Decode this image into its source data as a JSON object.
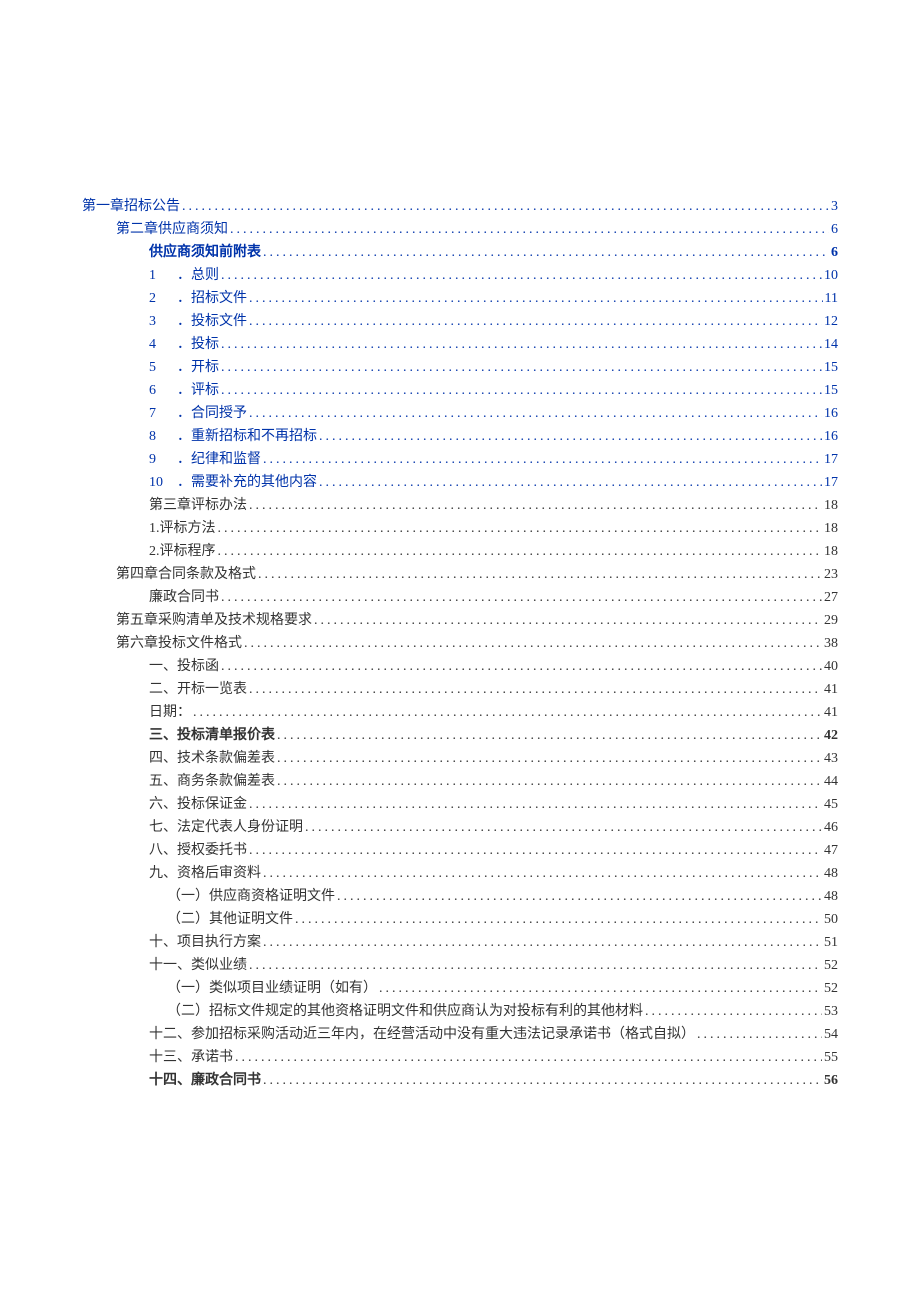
{
  "toc": [
    {
      "level": 0,
      "prefix": "",
      "label": "第一章招标公告",
      "page": "3",
      "link": true,
      "bold": false
    },
    {
      "level": 1,
      "prefix": "",
      "label": "第二章供应商须知",
      "page": "6",
      "link": true,
      "bold": false
    },
    {
      "level": 2,
      "prefix": "",
      "label": "供应商须知前附表",
      "page": "6",
      "link": true,
      "bold": true
    },
    {
      "level": 2,
      "prefix": "1",
      "label": "．总则",
      "page": "10",
      "link": true,
      "bold": false
    },
    {
      "level": 2,
      "prefix": "2",
      "label": "．招标文件",
      "page": "11",
      "link": true,
      "bold": false
    },
    {
      "level": 2,
      "prefix": "3",
      "label": "．投标文件",
      "page": "12",
      "link": true,
      "bold": false
    },
    {
      "level": 2,
      "prefix": "4",
      "label": "．投标",
      "page": "14",
      "link": true,
      "bold": false
    },
    {
      "level": 2,
      "prefix": "5",
      "label": "．开标",
      "page": "15",
      "link": true,
      "bold": false
    },
    {
      "level": 2,
      "prefix": "6",
      "label": "．评标",
      "page": "15",
      "link": true,
      "bold": false
    },
    {
      "level": 2,
      "prefix": "7",
      "label": "．合同授予",
      "page": "16",
      "link": true,
      "bold": false
    },
    {
      "level": 2,
      "prefix": "8",
      "label": "．重新招标和不再招标",
      "page": "16",
      "link": true,
      "bold": false
    },
    {
      "level": 2,
      "prefix": "9",
      "label": "．纪律和监督",
      "page": "17",
      "link": true,
      "bold": false
    },
    {
      "level": 2,
      "prefix": "10",
      "label": "．需要补充的其他内容",
      "page": "17",
      "link": true,
      "bold": false
    },
    {
      "level": 2,
      "prefix": "",
      "label": "第三章评标办法",
      "page": "18",
      "link": false,
      "bold": false
    },
    {
      "level": 2,
      "prefix": "",
      "label": "1.评标方法",
      "page": "18",
      "link": false,
      "bold": false
    },
    {
      "level": 2,
      "prefix": "",
      "label": "2.评标程序",
      "page": "18",
      "link": false,
      "bold": false
    },
    {
      "level": 1,
      "prefix": "",
      "label": "第四章合同条款及格式",
      "page": "23",
      "link": false,
      "bold": false
    },
    {
      "level": 2,
      "prefix": "",
      "label": "廉政合同书",
      "page": "27",
      "link": false,
      "bold": false
    },
    {
      "level": 1,
      "prefix": "",
      "label": "第五章采购清单及技术规格要求",
      "page": "29",
      "link": false,
      "bold": false
    },
    {
      "level": 1,
      "prefix": "",
      "label": "第六章投标文件格式",
      "page": "38",
      "link": false,
      "bold": false
    },
    {
      "level": 2,
      "prefix": "",
      "label": "一、投标函",
      "page": "40",
      "link": false,
      "bold": false
    },
    {
      "level": 2,
      "prefix": "",
      "label": "二、开标一览表",
      "page": "41",
      "link": false,
      "bold": false
    },
    {
      "level": 2,
      "prefix": "",
      "label": "日期：",
      "page": "41",
      "link": false,
      "bold": false
    },
    {
      "level": 2,
      "prefix": "",
      "label": "三、投标清单报价表",
      "page": "42",
      "link": false,
      "bold": true
    },
    {
      "level": 2,
      "prefix": "",
      "label": "四、技术条款偏差表",
      "page": "43",
      "link": false,
      "bold": false
    },
    {
      "level": 2,
      "prefix": "",
      "label": "五、商务条款偏差表",
      "page": "44",
      "link": false,
      "bold": false
    },
    {
      "level": 2,
      "prefix": "",
      "label": "六、投标保证金",
      "page": "45",
      "link": false,
      "bold": false
    },
    {
      "level": 2,
      "prefix": "",
      "label": "七、法定代表人身份证明",
      "page": "46",
      "link": false,
      "bold": false
    },
    {
      "level": 2,
      "prefix": "",
      "label": "八、授权委托书",
      "page": "47",
      "link": false,
      "bold": false
    },
    {
      "level": 2,
      "prefix": "",
      "label": "九、资格后审资料",
      "page": "48",
      "link": false,
      "bold": false
    },
    {
      "level": 3,
      "prefix": "",
      "label": "（一）供应商资格证明文件",
      "page": "48",
      "link": false,
      "bold": false
    },
    {
      "level": 3,
      "prefix": "",
      "label": "（二）其他证明文件",
      "page": "50",
      "link": false,
      "bold": false
    },
    {
      "level": 2,
      "prefix": "",
      "label": "十、项目执行方案",
      "page": "51",
      "link": false,
      "bold": false
    },
    {
      "level": 2,
      "prefix": "",
      "label": "十一、类似业绩",
      "page": "52",
      "link": false,
      "bold": false
    },
    {
      "level": 3,
      "prefix": "",
      "label": "（一）类似项目业绩证明（如有）",
      "page": "52",
      "link": false,
      "bold": false
    },
    {
      "level": 3,
      "prefix": "",
      "label": "（二）招标文件规定的其他资格证明文件和供应商认为对投标有利的其他材料",
      "page": "53",
      "link": false,
      "bold": false
    },
    {
      "level": 2,
      "prefix": "",
      "label": "十二、参加招标采购活动近三年内，在经营活动中没有重大违法记录承诺书（格式自拟）",
      "page": "54",
      "link": false,
      "bold": false
    },
    {
      "level": 2,
      "prefix": "",
      "label": "十三、承诺书",
      "page": "55",
      "link": false,
      "bold": false
    },
    {
      "level": 2,
      "prefix": "",
      "label": "十四、廉政合同书",
      "page": "56",
      "link": false,
      "bold": true
    }
  ]
}
